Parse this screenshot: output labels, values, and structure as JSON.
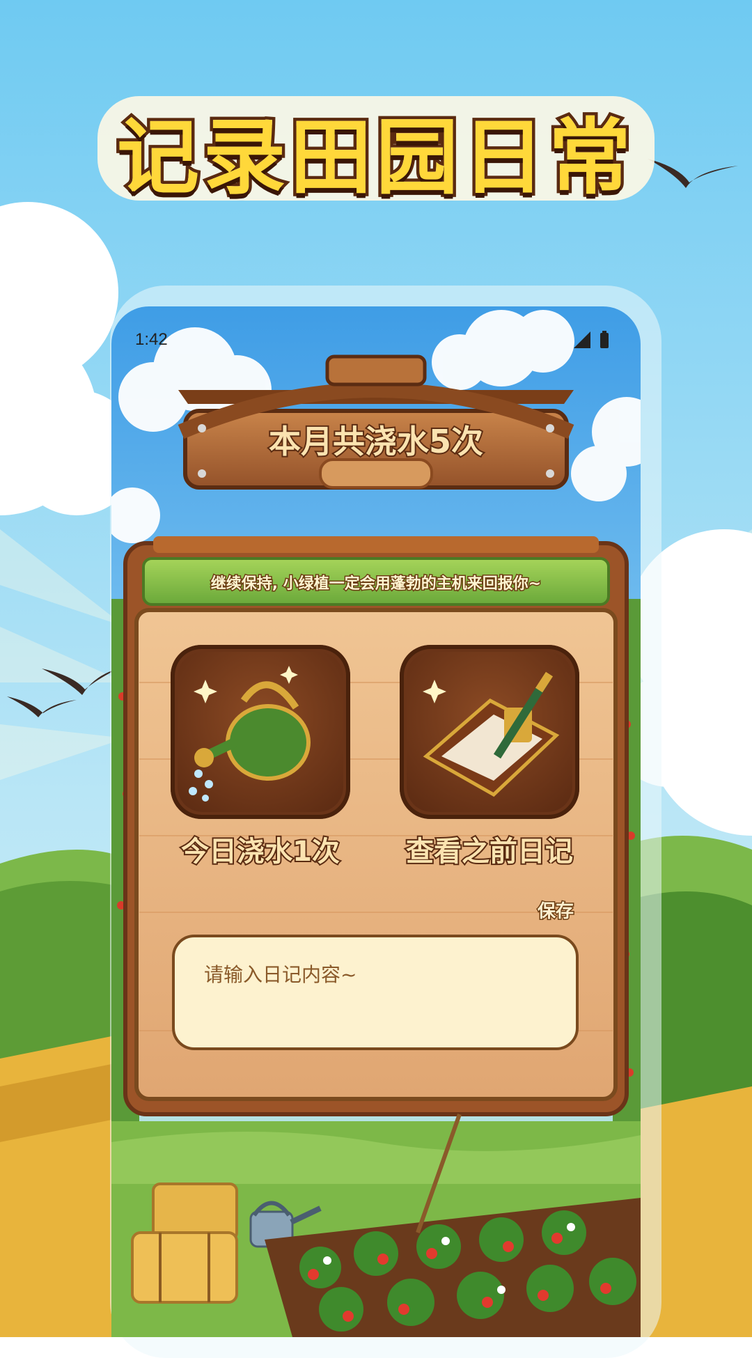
{
  "headline": "记录田园日常",
  "status_bar": {
    "time": "1:42",
    "icons": [
      "signal-icon",
      "battery-icon"
    ]
  },
  "sign": {
    "title": "本月共浇水5次"
  },
  "banner": {
    "text": "继续保持, 小绿植一定会用蓬勃的主机来回报你~"
  },
  "actions": [
    {
      "label": "今日浇水1次",
      "icon": "watering-can-icon"
    },
    {
      "label": "查看之前日记",
      "icon": "diary-book-icon"
    }
  ],
  "diary": {
    "save_label": "保存",
    "placeholder": "请输入日记内容~"
  },
  "colors": {
    "sky": "#7fcdf0",
    "wood": "#b86a32",
    "panel": "#e8b27a",
    "text_fill": "#fbe3b0",
    "text_stroke": "#5b2c12",
    "accent_green": "#7dc23a"
  }
}
